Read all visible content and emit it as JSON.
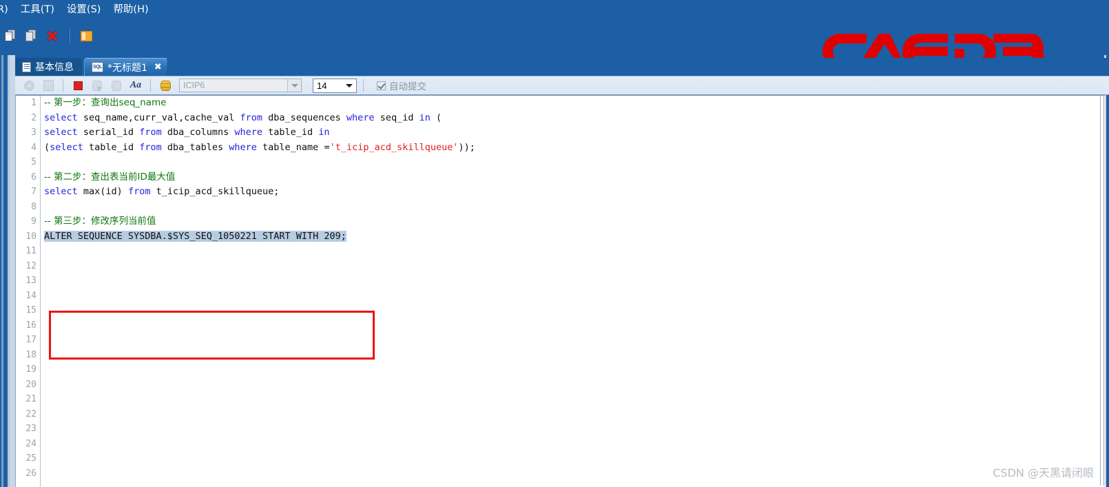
{
  "window": {
    "accent_blue": "#1C5FA5",
    "logo_red": "#E00000"
  },
  "menu": {
    "items": [
      {
        "label": "R)"
      },
      {
        "label": "工具(T)"
      },
      {
        "label": "设置(S)"
      },
      {
        "label": "帮助(H)"
      }
    ]
  },
  "top_toolbar": {
    "buttons": [
      {
        "name": "new-document-button",
        "icon": "new-document-icon"
      },
      {
        "name": "copy-documents-button",
        "icon": "copy-documents-icon"
      },
      {
        "name": "delete-button",
        "icon": "red-x-icon"
      },
      {
        "name": "window-button",
        "icon": "orange-window-icon"
      }
    ]
  },
  "logo": {
    "text": "CAEDB"
  },
  "tabs": [
    {
      "label": "基本信息",
      "icon": "document-icon",
      "active": false,
      "closable": false
    },
    {
      "label": "*无标题1",
      "icon": "sql-file-icon",
      "badge": "SQL",
      "active": true,
      "closable": true,
      "close_label": "✖"
    }
  ],
  "editor_toolbar": {
    "gear_icon": "gear-icon",
    "stack_icon": "stacked-documents-icon",
    "stop_icon": "stop-icon",
    "commit_icon": "commit-icon",
    "rollback_icon": "rollback-icon",
    "font_icon_label": "Aa",
    "database_icon": "database-icon",
    "connection": {
      "value": "ICIP6",
      "placeholder": "ICIP6"
    },
    "font_size": {
      "value": "14"
    },
    "autocommit": {
      "label": "自动提交",
      "checked": true
    }
  },
  "editor": {
    "total_lines": 26,
    "line_numbers": [
      "1",
      "2",
      "3",
      "4",
      "5",
      "6",
      "7",
      "8",
      "9",
      "10",
      "11",
      "12",
      "13",
      "14",
      "15",
      "16",
      "17",
      "18",
      "19",
      "20",
      "21",
      "22",
      "23",
      "24",
      "25",
      "26"
    ],
    "lines": [
      {
        "n": 1,
        "tokens": [
          {
            "t": "-- 第一步：查询出seq_name",
            "c": "cmt"
          }
        ]
      },
      {
        "n": 2,
        "tokens": [
          {
            "t": "select",
            "c": "kw"
          },
          {
            "t": " seq_name,curr_val,cache_val ",
            "c": ""
          },
          {
            "t": "from",
            "c": "kw"
          },
          {
            "t": " dba_sequences ",
            "c": ""
          },
          {
            "t": "where",
            "c": "kw"
          },
          {
            "t": " seq_id ",
            "c": ""
          },
          {
            "t": "in",
            "c": "kw"
          },
          {
            "t": " (",
            "c": ""
          }
        ]
      },
      {
        "n": 3,
        "tokens": [
          {
            "t": "select",
            "c": "kw"
          },
          {
            "t": " serial_id ",
            "c": ""
          },
          {
            "t": "from",
            "c": "kw"
          },
          {
            "t": " dba_columns ",
            "c": ""
          },
          {
            "t": "where",
            "c": "kw"
          },
          {
            "t": " table_id ",
            "c": ""
          },
          {
            "t": "in",
            "c": "kw"
          }
        ]
      },
      {
        "n": 4,
        "tokens": [
          {
            "t": "(",
            "c": ""
          },
          {
            "t": "select",
            "c": "kw"
          },
          {
            "t": " table_id ",
            "c": ""
          },
          {
            "t": "from",
            "c": "kw"
          },
          {
            "t": " dba_tables ",
            "c": ""
          },
          {
            "t": "where",
            "c": "kw"
          },
          {
            "t": " table_name =",
            "c": ""
          },
          {
            "t": "'t_icip_acd_skillqueue'",
            "c": "str"
          },
          {
            "t": "));",
            "c": ""
          }
        ]
      },
      {
        "n": 5,
        "tokens": []
      },
      {
        "n": 6,
        "tokens": [
          {
            "t": "-- 第二步：查出表当前ID最大值",
            "c": "cmt"
          }
        ]
      },
      {
        "n": 7,
        "tokens": [
          {
            "t": "select",
            "c": "kw"
          },
          {
            "t": " max(id) ",
            "c": ""
          },
          {
            "t": "from",
            "c": "kw"
          },
          {
            "t": " t_icip_acd_skillqueue;",
            "c": ""
          }
        ]
      },
      {
        "n": 8,
        "tokens": []
      },
      {
        "n": 9,
        "tokens": [
          {
            "t": "-- 第三步：修改序列当前值",
            "c": "cmt"
          }
        ]
      },
      {
        "n": 10,
        "tokens": [
          {
            "t": "ALTER SEQUENCE SYSDBA.$SYS_SEQ_1050221 START WITH 209;",
            "c": "sel"
          }
        ]
      },
      {
        "n": 11,
        "tokens": []
      },
      {
        "n": 12,
        "tokens": []
      },
      {
        "n": 13,
        "tokens": []
      },
      {
        "n": 14,
        "tokens": []
      },
      {
        "n": 15,
        "tokens": []
      },
      {
        "n": 16,
        "tokens": []
      },
      {
        "n": 17,
        "tokens": []
      },
      {
        "n": 18,
        "tokens": []
      },
      {
        "n": 19,
        "tokens": []
      },
      {
        "n": 20,
        "tokens": []
      },
      {
        "n": 21,
        "tokens": []
      },
      {
        "n": 22,
        "tokens": []
      },
      {
        "n": 23,
        "tokens": []
      },
      {
        "n": 24,
        "tokens": []
      },
      {
        "n": 25,
        "tokens": []
      },
      {
        "n": 26,
        "tokens": []
      }
    ],
    "selected_text": "ALTER SEQUENCE SYSDBA.$SYS_SEQ_1050221 START WITH 209;",
    "annotation": {
      "shape": "rectangle",
      "color": "#EE1111",
      "covers_lines": "8-11"
    },
    "syntax_colors": {
      "keyword": "#2222DD",
      "string": "#E02020",
      "comment": "#117711",
      "selection_bg": "#B6CCE2"
    }
  },
  "watermark": {
    "text": "CSDN @天黑请闭眼"
  }
}
